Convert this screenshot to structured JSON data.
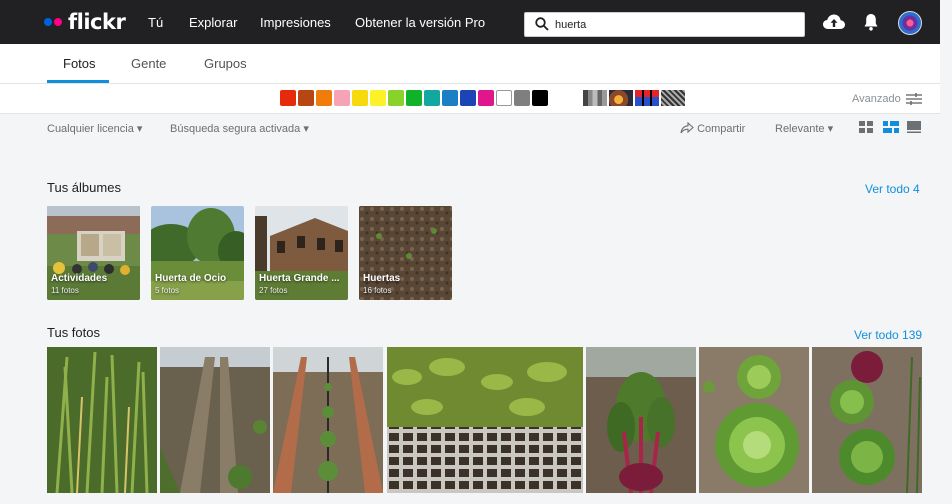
{
  "nav": {
    "logo_text": "flickr",
    "links": [
      "Tú",
      "Explorar",
      "Impresiones",
      "Obtener la versión Pro"
    ],
    "search_value": "huerta",
    "icons": [
      "upload-cloud-icon",
      "notification-bell-icon",
      "avatar"
    ]
  },
  "tabs": [
    {
      "label": "Fotos",
      "active": true
    },
    {
      "label": "Gente",
      "active": false
    },
    {
      "label": "Grupos",
      "active": false
    }
  ],
  "color_filters": {
    "colors": [
      "#e62b0d",
      "#b84613",
      "#f07c0c",
      "#f5a3b5",
      "#f7da0e",
      "#fdf229",
      "#8ad12b",
      "#10b22a",
      "#12a8a0",
      "#1c7ec5",
      "#1c44b4",
      "#e0168c",
      "#ffffff",
      "#7f7f7f",
      "#000000"
    ],
    "styles": [
      "black-and-white-style",
      "shallow-depth-of-field-style",
      "minimalist-style",
      "patterns-style"
    ],
    "advanced_label": "Avanzado"
  },
  "filters": {
    "license": "Cualquier licencia",
    "safe_search": "Búsqueda segura activada",
    "share": "Compartir",
    "sort": "Relevante"
  },
  "albums_section": {
    "title": "Tus álbumes",
    "see_all": "Ver todo 4",
    "albums": [
      {
        "title": "Actividades",
        "count": "11 fotos"
      },
      {
        "title": "Huerta de Ocio",
        "count": "5 fotos"
      },
      {
        "title": "Huerta Grande ...",
        "count": "27 fotos"
      },
      {
        "title": "Huertas",
        "count": "16 fotos"
      }
    ]
  },
  "photos_section": {
    "title": "Tus fotos",
    "see_all": "Ver todo 139"
  },
  "colors": {
    "nav_bg": "#212124",
    "accent": "#128fdc",
    "page_bg": "#f3f5f6"
  }
}
